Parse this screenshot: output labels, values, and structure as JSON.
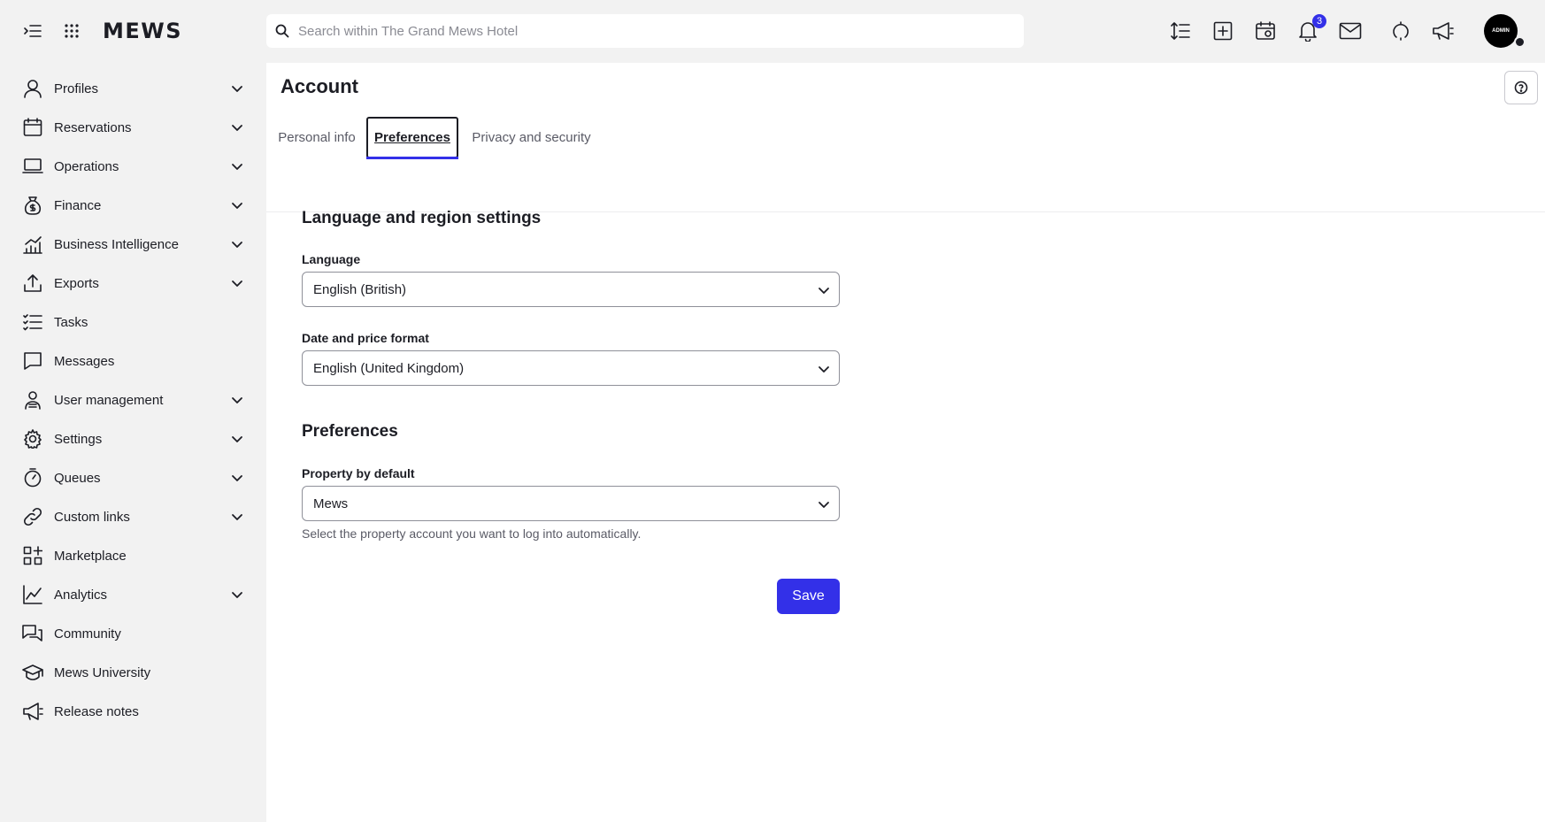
{
  "topbar": {
    "logo": "MEWS",
    "search_placeholder": "Search within The Grand Mews Hotel",
    "notifications_count": "3",
    "avatar_label": "ADMIN"
  },
  "sidebar": {
    "items": [
      {
        "label": "Profiles",
        "icon": "person-icon",
        "expandable": true
      },
      {
        "label": "Reservations",
        "icon": "calendar-icon",
        "expandable": true
      },
      {
        "label": "Operations",
        "icon": "laptop-icon",
        "expandable": true
      },
      {
        "label": "Finance",
        "icon": "money-bag-icon",
        "expandable": true
      },
      {
        "label": "Business Intelligence",
        "icon": "bar-chart-icon",
        "expandable": true
      },
      {
        "label": "Exports",
        "icon": "upload-icon",
        "expandable": true
      },
      {
        "label": "Tasks",
        "icon": "checklist-icon",
        "expandable": false
      },
      {
        "label": "Messages",
        "icon": "message-icon",
        "expandable": false
      },
      {
        "label": "User management",
        "icon": "user-management-icon",
        "expandable": true
      },
      {
        "label": "Settings",
        "icon": "gear-icon",
        "expandable": true
      },
      {
        "label": "Queues",
        "icon": "stopwatch-icon",
        "expandable": true
      },
      {
        "label": "Custom links",
        "icon": "link-icon",
        "expandable": true
      },
      {
        "label": "Marketplace",
        "icon": "apps-icon",
        "expandable": false
      },
      {
        "label": "Analytics",
        "icon": "line-chart-icon",
        "expandable": true
      },
      {
        "label": "Community",
        "icon": "chat-bubbles-icon",
        "expandable": false
      },
      {
        "label": "Mews University",
        "icon": "graduation-cap-icon",
        "expandable": false
      },
      {
        "label": "Release notes",
        "icon": "megaphone-icon",
        "expandable": false
      }
    ]
  },
  "main": {
    "title": "Account",
    "tabs": [
      {
        "label": "Personal info",
        "active": false
      },
      {
        "label": "Preferences",
        "active": true
      },
      {
        "label": "Privacy and security",
        "active": false
      }
    ],
    "language_section": {
      "title": "Language and region settings",
      "language_label": "Language",
      "language_value": "English (British)",
      "format_label": "Date and price format",
      "format_value": "English (United Kingdom)"
    },
    "preferences_section": {
      "title": "Preferences",
      "property_label": "Property by default",
      "property_value": "Mews",
      "property_hint": "Select the property account you want to log into automatically."
    },
    "save_label": "Save"
  },
  "colors": {
    "accent": "#3330e8",
    "background": "#f2f2f2",
    "panel": "#ffffff",
    "text": "#1c1d24"
  }
}
